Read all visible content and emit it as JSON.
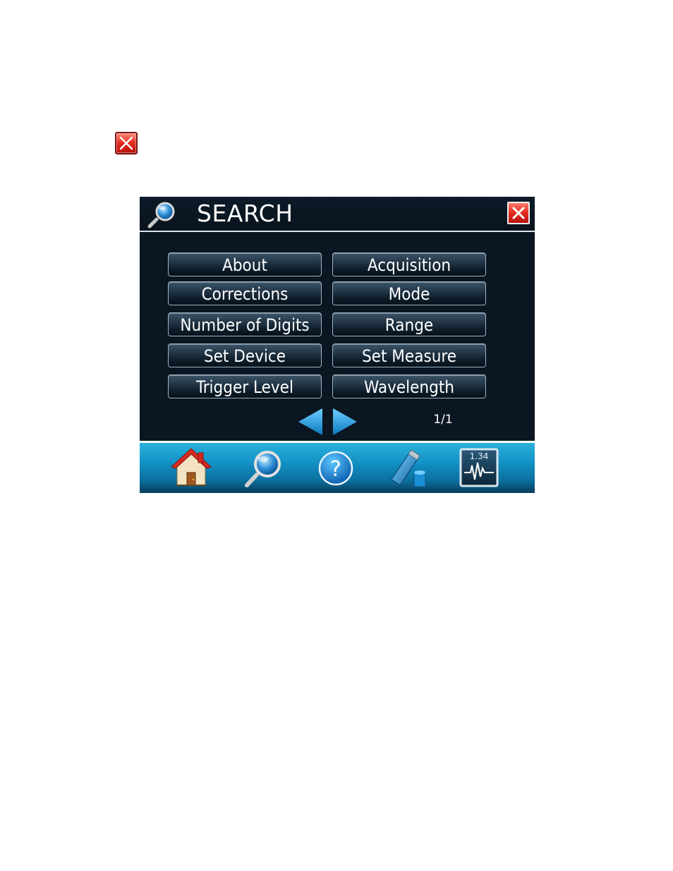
{
  "screen": {
    "title": "SEARCH",
    "menu_items": [
      "About",
      "Acquisition",
      "Corrections",
      "Mode",
      "Number of Digits",
      "Range",
      "Set Device",
      "Set Measure",
      "Trigger Level",
      "Wavelength"
    ],
    "page_indicator": "1/1",
    "measure_icon_value": "1.34"
  },
  "icons": {
    "page_close": "close-icon",
    "title": "search-icon",
    "dialog_close": "close-icon",
    "prev": "arrow-left-icon",
    "next": "arrow-right-icon",
    "nav": [
      "home-icon",
      "search-icon",
      "help-icon",
      "usb-storage-icon",
      "measurement-display-icon"
    ]
  },
  "colors": {
    "screen_background": "#0a1621",
    "bottom_bar": "#1391c4",
    "close_red": "#e22b1f",
    "arrow_blue": "#1ea0e0"
  }
}
